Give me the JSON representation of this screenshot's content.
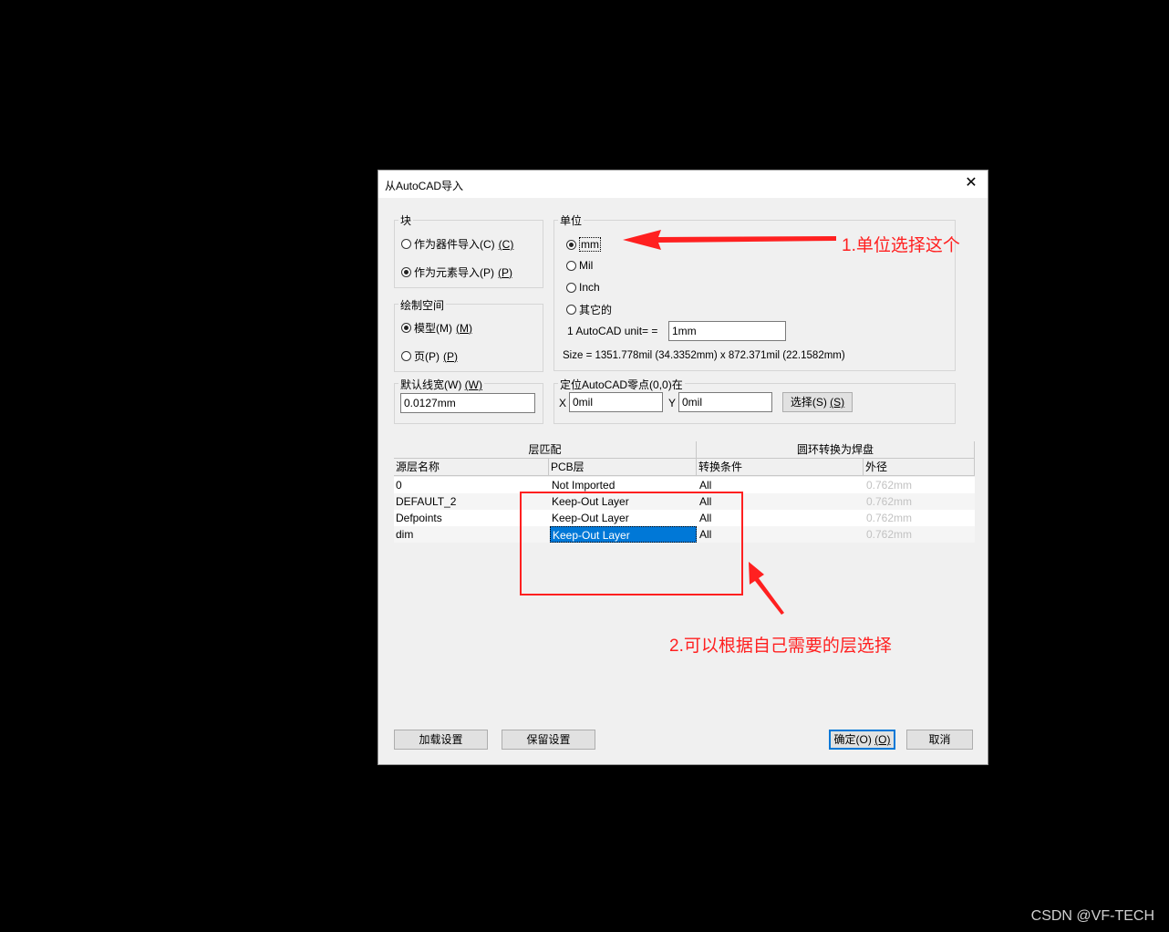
{
  "dialog": {
    "title": "从AutoCAD导入",
    "close_glyph": "✕"
  },
  "block_group": {
    "label": "块",
    "option_component": "作为器件导入(C)",
    "option_component_key": "(C)",
    "option_element": "作为元素导入(P)",
    "option_element_key": "(P)",
    "selected": "element"
  },
  "space_group": {
    "label": "绘制空间",
    "option_model": "模型(M)",
    "option_model_key": "(M)",
    "option_page": "页(P)",
    "option_page_key": "(P)",
    "selected": "model"
  },
  "units_group": {
    "label": "单位",
    "options": [
      "mm",
      "Mil",
      "Inch",
      "其它的"
    ],
    "selected": "mm",
    "unit_label": "1 AutoCAD unit= =",
    "unit_value": "1mm",
    "size_text": "Size = 1351.778mil (34.3352mm) x 872.371mil (22.1582mm)"
  },
  "linewidth_group": {
    "label": "默认线宽(W)",
    "label_key": "(W)",
    "value": "0.0127mm"
  },
  "origin_group": {
    "label": "定位AutoCAD零点(0,0)在",
    "x_label": "X",
    "x_value": "0mil",
    "y_label": "Y",
    "y_value": "0mil",
    "select_button": "选择(S)",
    "select_button_key": "(S)"
  },
  "layer_table": {
    "group_header_left": "层匹配",
    "group_header_right": "圆环转换为焊盘",
    "columns": [
      "源层名称",
      "PCB层",
      "转换条件",
      "外径"
    ],
    "rows": [
      {
        "source": "0",
        "pcb": "Not Imported",
        "condition": "All",
        "diameter": "0.762mm"
      },
      {
        "source": "DEFAULT_2",
        "pcb": "Keep-Out Layer",
        "condition": "All",
        "diameter": "0.762mm"
      },
      {
        "source": "Defpoints",
        "pcb": "Keep-Out Layer",
        "condition": "All",
        "diameter": "0.762mm"
      },
      {
        "source": "dim",
        "pcb": "Keep-Out Layer",
        "condition": "All",
        "diameter": "0.762mm"
      }
    ]
  },
  "buttons": {
    "load": "加载设置",
    "save": "保留设置",
    "ok": "确定(O)",
    "ok_key": "(O)",
    "cancel": "取消"
  },
  "annotations": {
    "note1": "1.单位选择这个",
    "note2": "2.可以根据自己需要的层选择",
    "color": "#ff2020"
  },
  "watermark": "CSDN @VF-TECH"
}
